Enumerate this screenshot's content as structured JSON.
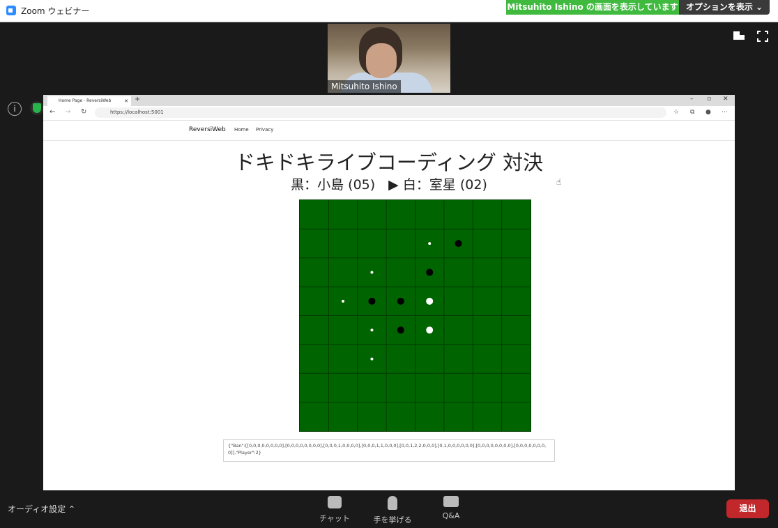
{
  "zoom": {
    "window_title": "Zoom ウェビナー",
    "share_banner": "Mitsuhito  Ishino  の画面を表示しています",
    "options_label": "オプションを表示 ⌄",
    "speaker_name": "Mitsuhito Ishino",
    "audio_settings": "オーディオ設定 ⌃",
    "chat_label": "チャット",
    "raise_hand_label": "手を挙げる",
    "qa_label": "Q&A",
    "leave_label": "退出"
  },
  "browser": {
    "tab_title": "Home Page - ReversiWeb",
    "url": "https://localhost:5001"
  },
  "site": {
    "brand": "ReversiWeb",
    "nav": [
      "Home",
      "Privacy"
    ],
    "title": "ドキドキライブコーディング 対決",
    "status": "黒：小島 (05)　▶ 白：室星 (02)"
  },
  "board": {
    "size": 8,
    "cells": [
      [
        0,
        0,
        0,
        0,
        0,
        0,
        0,
        0
      ],
      [
        0,
        0,
        0,
        0,
        3,
        1,
        0,
        0
      ],
      [
        0,
        0,
        3,
        0,
        1,
        0,
        0,
        0
      ],
      [
        0,
        3,
        1,
        1,
        2,
        0,
        0,
        0
      ],
      [
        0,
        0,
        3,
        1,
        2,
        0,
        0,
        0
      ],
      [
        0,
        0,
        3,
        0,
        0,
        0,
        0,
        0
      ],
      [
        0,
        0,
        0,
        0,
        0,
        0,
        0,
        0
      ],
      [
        0,
        0,
        0,
        0,
        0,
        0,
        0,
        0
      ]
    ],
    "legend": "0=empty, 1=black, 2=white, 3=legal-move-hint"
  },
  "json_text": "{\"Ban\":[[0,0,0,0,0,0,0,0],[0,0,0,0,0,0,0,0],[0,0,0,1,0,0,0,0],[0,0,0,1,1,0,0,0],[0,0,1,2,2,0,0,0],[0,1,0,0,0,0,0,0],[0,0,0,0,0,0,0,0],[0,0,0,0,0,0,0,0]],\"Player\":2}"
}
